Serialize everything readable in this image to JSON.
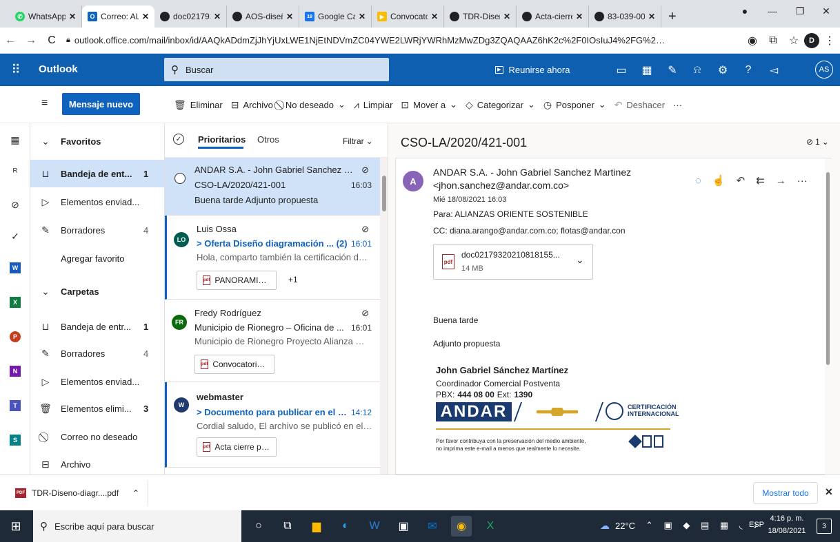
{
  "browser": {
    "tabs": [
      {
        "label": "WhatsApp",
        "color": "#25d366",
        "glyph": "✆"
      },
      {
        "label": "Correo: AL",
        "color": "#0f62be",
        "glyph": "O"
      },
      {
        "label": "doc021793",
        "color": "#202124",
        "glyph": "●"
      },
      {
        "label": "AOS-diseñ",
        "color": "#202124",
        "glyph": "●"
      },
      {
        "label": "Google Cal",
        "color": "#1a73e8",
        "glyph": "18"
      },
      {
        "label": "Convocato",
        "color": "#fbbc04",
        "glyph": "▶"
      },
      {
        "label": "TDR-Diseñ",
        "color": "#202124",
        "glyph": "●"
      },
      {
        "label": "Acta-cierre",
        "color": "#202124",
        "glyph": "●"
      },
      {
        "label": "83-039-00",
        "color": "#202124",
        "glyph": "●"
      }
    ],
    "url": "outlook.office.com/mail/inbox/id/AAQkADdmZjJhYjUxLWE1NjEtNDVmZC04YWE2LWRjYWRhMzMwZDg3ZQAQAAZ6hK2c%2F0IOsIuJ4%2FG%2B%2FMI%3D",
    "profile_initial": "D"
  },
  "header": {
    "app_name": "Outlook",
    "search_placeholder": "Buscar",
    "meet_now": "Reunirse ahora",
    "user_initials": "AS"
  },
  "command_bar": {
    "new_message": "Mensaje nuevo",
    "delete": "Eliminar",
    "archive": "Archivo",
    "junk": "No deseado",
    "sweep": "Limpiar",
    "move_to": "Mover a",
    "categorize": "Categorizar",
    "snooze": "Posponer",
    "undo": "Deshacer",
    "more": "···"
  },
  "folders": {
    "favorites_header": "Favoritos",
    "favorites": [
      {
        "label": "Bandeja de ent...",
        "count": "1"
      },
      {
        "label": "Elementos enviad...",
        "count": ""
      },
      {
        "label": "Borradores",
        "count": "4"
      },
      {
        "label": "Agregar favorito",
        "count": ""
      }
    ],
    "folders_header": "Carpetas",
    "folder_items": [
      {
        "label": "Bandeja de entr...",
        "count": "1"
      },
      {
        "label": "Borradores",
        "count": "4"
      },
      {
        "label": "Elementos enviad...",
        "count": ""
      },
      {
        "label": "Elementos elimi...",
        "count": "3"
      },
      {
        "label": "Correo no deseado",
        "count": ""
      },
      {
        "label": "Archivo",
        "count": ""
      }
    ]
  },
  "message_list": {
    "tab_focused": "Prioritarios",
    "tab_other": "Otros",
    "filter": "Filtrar",
    "messages": [
      {
        "sender": "ANDAR S.A. - John Gabriel Sanchez M...",
        "subject": "CSO-LA/2020/421-001",
        "time": "16:03",
        "preview": "Buena tarde Adjunto propuesta",
        "initials": "",
        "color": "",
        "attachment": "",
        "extra": ""
      },
      {
        "sender": "Luis Ossa",
        "subject": "> Oferta Diseño diagramación ... (2)",
        "time": "16:01",
        "preview": "Hola, comparto también la certificación de c...",
        "initials": "LO",
        "color": "#005e50",
        "attachment": "PANORAMICA ...",
        "extra": "+1"
      },
      {
        "sender": "Fredy Rodríguez",
        "subject": "Municipio de Rionegro – Oficina de ...",
        "time": "16:01",
        "preview": "Municipio de Rionegro Proyecto Alianza Ori...",
        "initials": "FR",
        "color": "#0b6a0b",
        "attachment": "Convocatoria C...",
        "extra": ""
      },
      {
        "sender": "webmaster",
        "subject": "> Documento para publicar en el li...",
        "time": "14:12",
        "preview": "Cordial saludo, El archivo se publicó en el e...",
        "initials": "W",
        "color": "#1f3a6e",
        "attachment": "Acta cierre prop...",
        "extra": ""
      }
    ]
  },
  "reading": {
    "subject": "CSO-LA/2020/421-001",
    "attach_count": "1",
    "sender_initial": "A",
    "sender_name": "ANDAR S.A. - John Gabriel Sanchez Martinez",
    "sender_email": "<jhon.sanchez@andar.com.co>",
    "date": "Mié 18/08/2021 16:03",
    "to": "Para:  ALIANZAS ORIENTE SOSTENIBLE",
    "cc": "CC:  diana.arango@andar.com.co; flotas@andar.con",
    "attachment_name": "doc02179320210818155...",
    "attachment_size": "14 MB",
    "greeting": "Buena tarde",
    "body": "Adjunto propuesta",
    "sig_name": "John Gabriel Sánchez Martínez",
    "sig_title": "Coordinador Comercial Postventa",
    "sig_pbx_label": "PBX:",
    "sig_pbx": "444 08 00",
    "sig_ext_label": "Ext:",
    "sig_ext": "1390",
    "logo_text": "ANDAR",
    "cert_line1": "CERTIFICACIÓN",
    "cert_line2": "INTERNACIONAL",
    "eco_line1": "Por favor contribuya con la preservación del medio ambiente,",
    "eco_line2": "no imprima este e-mail a menos que realmente lo necesite."
  },
  "downloads": {
    "file": "TDR-Diseno-diagr....pdf",
    "show_all": "Mostrar todo"
  },
  "taskbar": {
    "search": "Escribe aquí para buscar",
    "temp": "22°C",
    "lang": "ESP",
    "time": "4:16 p. m.",
    "date": "18/08/2021",
    "notif_count": "3"
  }
}
